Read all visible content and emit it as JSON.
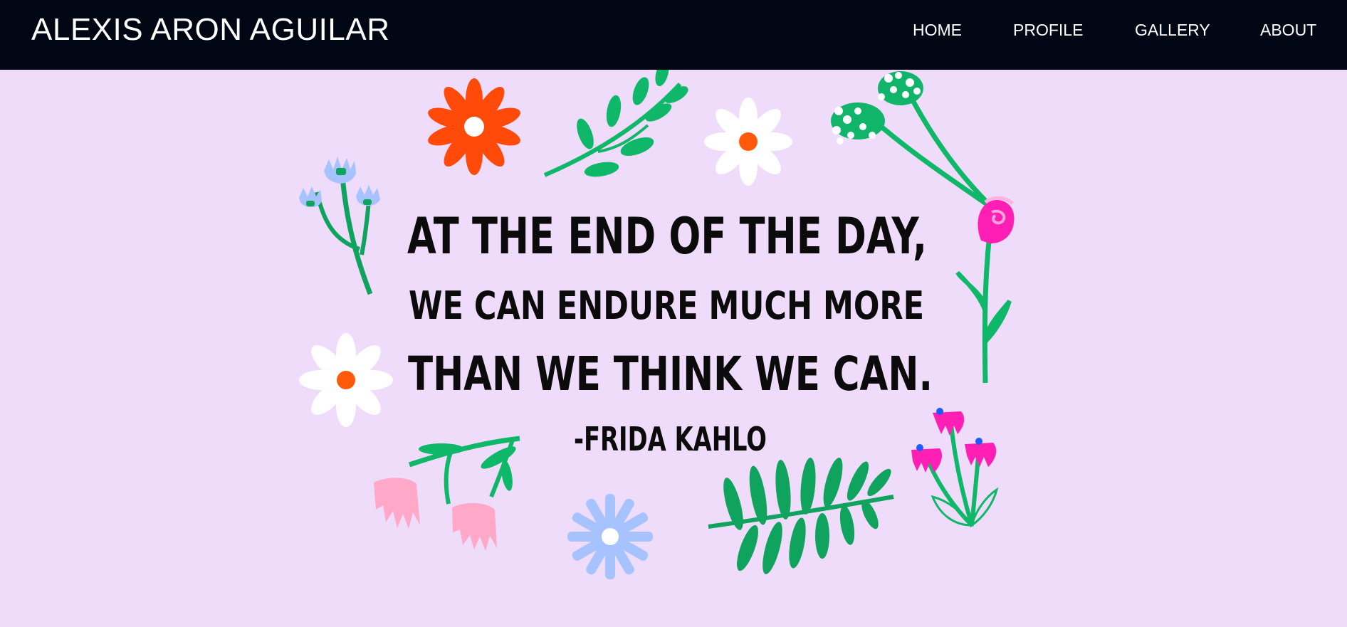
{
  "header": {
    "brand": "ALEXIS ARON AGUILAR",
    "nav": [
      {
        "label": "HOME"
      },
      {
        "label": "PROFILE"
      },
      {
        "label": "GALLERY"
      },
      {
        "label": "ABOUT"
      }
    ]
  },
  "hero": {
    "quote_lines": [
      "AT THE END OF THE DAY,",
      "WE CAN ENDURE MUCH MORE",
      "THAN WE THINK WE CAN."
    ],
    "author": "-FRIDA KAHLO"
  },
  "colors": {
    "header_bg": "#010614",
    "page_bg": "#efdcfb",
    "leaf_green": "#0fa35e",
    "orange_flower": "#ff4a0a",
    "pink_flower": "#ff1fb4",
    "blue_flower": "#a6c3ff"
  },
  "icons": [
    "red-flower-icon",
    "white-daisy-icon",
    "blue-flower-icon",
    "pink-tulip-icon",
    "leaf-branch-icon",
    "fern-leaf-icon"
  ]
}
